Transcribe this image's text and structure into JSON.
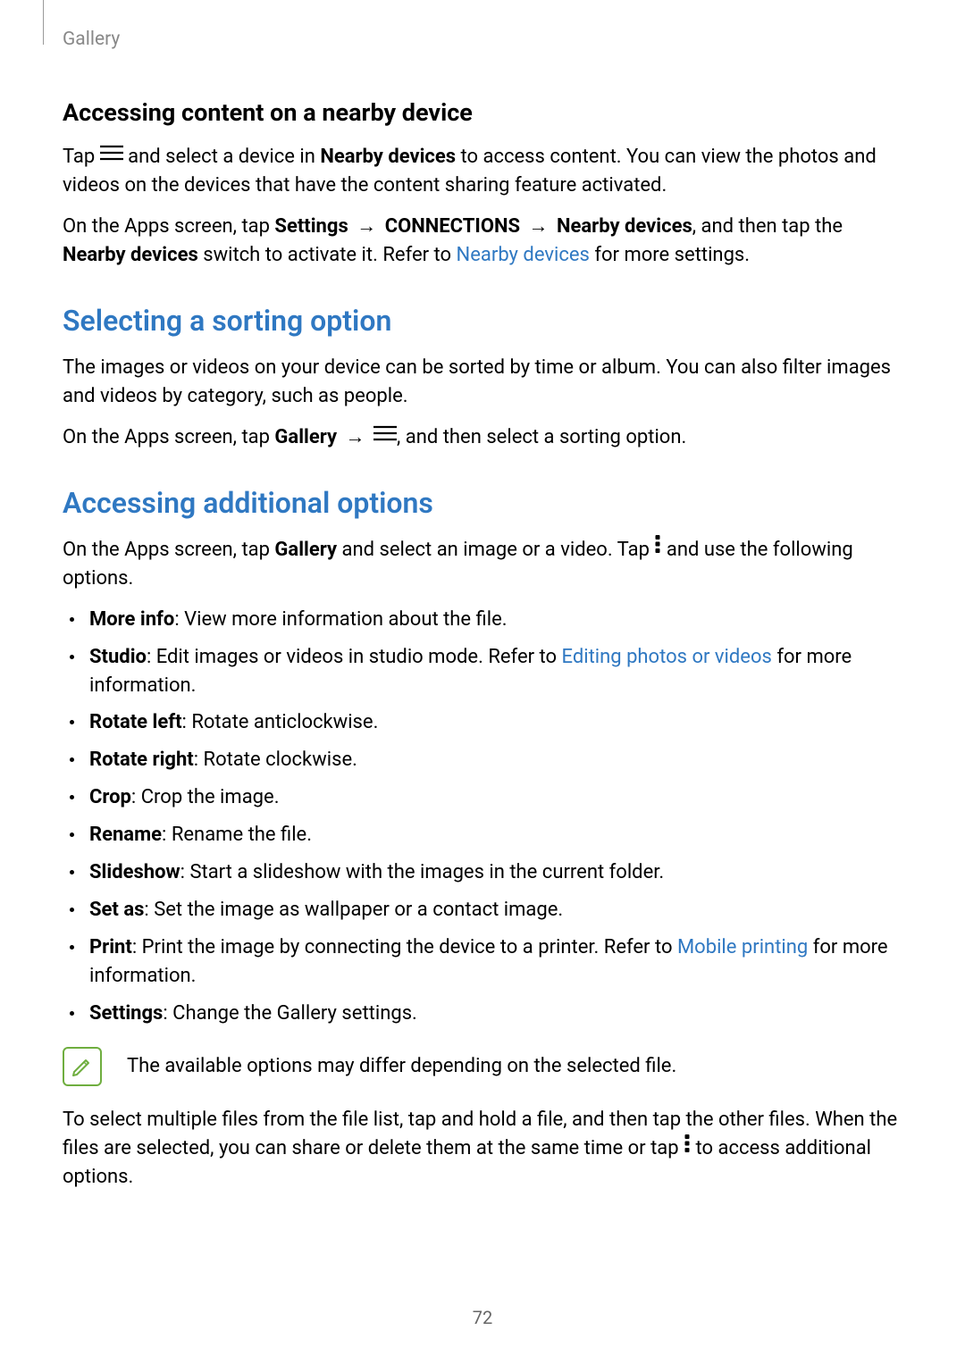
{
  "breadcrumb": "Gallery",
  "page_number": "72",
  "h3_nearby": "Accessing content on a nearby device",
  "p_nearby_1a": "Tap ",
  "p_nearby_1b": " and select a device in ",
  "p_nearby_1_bold1": "Nearby devices",
  "p_nearby_1c": " to access content. You can view the photos and videos on the devices that have the content sharing feature activated.",
  "p_nearby_2a": "On the Apps screen, tap ",
  "p_nearby_2_bold1": "Settings",
  "p_nearby_2_arrow1": " → ",
  "p_nearby_2_bold2": "CONNECTIONS",
  "p_nearby_2_arrow2": " → ",
  "p_nearby_2_bold3": "Nearby devices",
  "p_nearby_2b": ", and then tap the ",
  "p_nearby_2_bold4": "Nearby devices",
  "p_nearby_2c": " switch to activate it. Refer to ",
  "p_nearby_2_link": "Nearby devices",
  "p_nearby_2d": " for more settings.",
  "h2_sorting": "Selecting a sorting option",
  "p_sorting_1": "The images or videos on your device can be sorted by time or album. You can also filter images and videos by category, such as people.",
  "p_sorting_2a": "On the Apps screen, tap ",
  "p_sorting_2_bold1": "Gallery",
  "p_sorting_2_arrow": " → ",
  "p_sorting_2b": ", and then select a sorting option.",
  "h2_additional": "Accessing additional options",
  "p_add_1a": "On the Apps screen, tap ",
  "p_add_1_bold1": "Gallery",
  "p_add_1b": " and select an image or a video. Tap ",
  "p_add_1c": " and use the following options.",
  "options": {
    "more_info": {
      "label": "More info",
      "desc": ": View more information about the file."
    },
    "studio": {
      "label": "Studio",
      "desc1": ": Edit images or videos in studio mode. Refer to ",
      "link": "Editing photos or videos",
      "desc2": " for more information."
    },
    "rotate_left": {
      "label": "Rotate left",
      "desc": ": Rotate anticlockwise."
    },
    "rotate_right": {
      "label": "Rotate right",
      "desc": ": Rotate clockwise."
    },
    "crop": {
      "label": "Crop",
      "desc": ": Crop the image."
    },
    "rename": {
      "label": "Rename",
      "desc": ": Rename the file."
    },
    "slideshow": {
      "label": "Slideshow",
      "desc": ": Start a slideshow with the images in the current folder."
    },
    "set_as": {
      "label": "Set as",
      "desc": ": Set the image as wallpaper or a contact image."
    },
    "print": {
      "label": "Print",
      "desc1": ": Print the image by connecting the device to a printer. Refer to ",
      "link": "Mobile printing",
      "desc2": " for more information."
    },
    "settings": {
      "label": "Settings",
      "desc": ": Change the Gallery settings."
    }
  },
  "note_text": "The available options may differ depending on the selected file.",
  "p_multi_1": "To select multiple files from the file list, tap and hold a file, and then tap the other files. When the files are selected, you can share or delete them at the same time or tap ",
  "p_multi_2": " to access additional options."
}
